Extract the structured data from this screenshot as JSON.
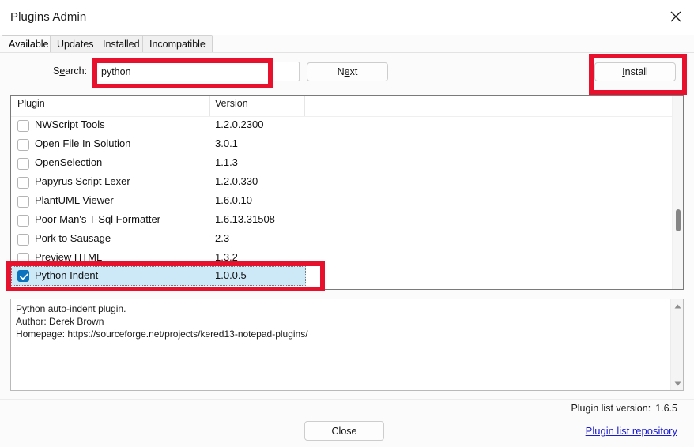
{
  "window": {
    "title": "Plugins Admin",
    "close_icon": "close-icon"
  },
  "tabs": [
    {
      "label": "Available",
      "active": true
    },
    {
      "label": "Updates",
      "active": false
    },
    {
      "label": "Installed",
      "active": false
    },
    {
      "label": "Incompatible",
      "active": false
    }
  ],
  "search": {
    "label_prefix": "S",
    "label_mnemonic": "e",
    "label_suffix": "arch:",
    "label_full": "Search:",
    "value": "python",
    "placeholder": ""
  },
  "buttons": {
    "next_prefix": "N",
    "next_mnemonic": "e",
    "next_suffix": "xt",
    "next_label": "Next",
    "install_prefix": "",
    "install_mnemonic": "I",
    "install_suffix": "nstall",
    "install_label": "Install",
    "close_label": "Close"
  },
  "list": {
    "columns": [
      "Plugin",
      "Version"
    ],
    "rows": [
      {
        "name": "NWScript Tools",
        "version": "1.2.0.2300",
        "checked": false
      },
      {
        "name": "Open File In Solution",
        "version": "3.0.1",
        "checked": false
      },
      {
        "name": "OpenSelection",
        "version": "1.1.3",
        "checked": false
      },
      {
        "name": "Papyrus Script Lexer",
        "version": "1.2.0.330",
        "checked": false
      },
      {
        "name": "PlantUML Viewer",
        "version": "1.6.0.10",
        "checked": false
      },
      {
        "name": "Poor Man's T-Sql Formatter",
        "version": "1.6.13.31508",
        "checked": false
      },
      {
        "name": "Pork to Sausage",
        "version": "2.3",
        "checked": false
      },
      {
        "name": "Preview HTML",
        "version": "1.3.2",
        "checked": false
      }
    ],
    "selected_row": {
      "name": "Python Indent",
      "version": "1.0.0.5",
      "checked": true
    }
  },
  "description": {
    "text": "Python auto-indent plugin.\nAuthor: Derek Brown\nHomepage: https://sourceforge.net/projects/kered13-notepad-plugins/"
  },
  "footer": {
    "plugin_list_version_label": "Plugin list version:",
    "plugin_list_version_value": "1.6.5",
    "repository_link": "Plugin list repository"
  },
  "colors": {
    "annotation_red": "#e8112d",
    "selection_blue": "#cde8f7",
    "checkbox_blue": "#0b72bd",
    "link_blue": "#1a1ad0"
  }
}
